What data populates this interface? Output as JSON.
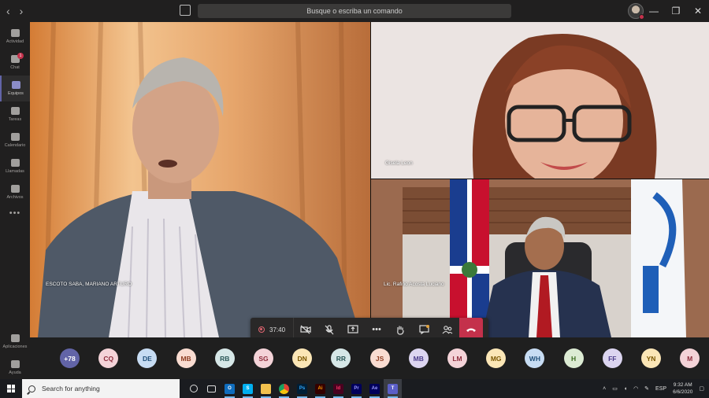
{
  "titlebar": {
    "back": "‹",
    "forward": "›",
    "search_placeholder": "Busque o escriba un comando",
    "minimize": "—",
    "maximize": "❐",
    "close": "✕"
  },
  "rail": {
    "items": [
      {
        "label": "Actividad",
        "icon": "bell-icon"
      },
      {
        "label": "Chat",
        "icon": "chat-icon",
        "badge": "1"
      },
      {
        "label": "Equipos",
        "icon": "teams-icon",
        "active": true
      },
      {
        "label": "Tareas",
        "icon": "tasks-icon"
      },
      {
        "label": "Calendario",
        "icon": "calendar-icon"
      },
      {
        "label": "Llamadas",
        "icon": "phone-icon"
      },
      {
        "label": "Archivos",
        "icon": "files-icon"
      }
    ],
    "more": "•••",
    "bottom": [
      {
        "label": "Aplicaciones",
        "icon": "apps-icon"
      },
      {
        "label": "Ayuda",
        "icon": "help-icon"
      }
    ]
  },
  "tiles": {
    "left_name": "ESCOTO SABA, MARIANO ARTURO",
    "top_right_name": "Gisela Leon",
    "bottom_right_name": "Lic. Rafino Acosta Luciano"
  },
  "controls": {
    "timer": "37:40",
    "icons": [
      "camera-icon",
      "mic-icon",
      "share-icon",
      "more-icon",
      "raise-hand-icon",
      "chat-icon",
      "participants-icon"
    ],
    "hangup_icon": "hangup-icon"
  },
  "participants": [
    {
      "initials": "+78",
      "bg": "#6264a7",
      "fg": "#ffffff"
    },
    {
      "initials": "CQ",
      "bg": "#f4d3d8",
      "fg": "#8e2c3c"
    },
    {
      "initials": "DE",
      "bg": "#c7dcf3",
      "fg": "#1f4e79"
    },
    {
      "initials": "MB",
      "bg": "#f9dcd1",
      "fg": "#8f3e22"
    },
    {
      "initials": "RB",
      "bg": "#d6e7e7",
      "fg": "#2b5757"
    },
    {
      "initials": "SG",
      "bg": "#f4d3d8",
      "fg": "#8e2c3c"
    },
    {
      "initials": "DN",
      "bg": "#fbe6b6",
      "fg": "#7a5600"
    },
    {
      "initials": "RR",
      "bg": "#d6e7e7",
      "fg": "#2b5757"
    },
    {
      "initials": "JS",
      "bg": "#f9dcd1",
      "fg": "#8f3e22"
    },
    {
      "initials": "MB",
      "bg": "#dcd5f0",
      "fg": "#4b3c8a"
    },
    {
      "initials": "LM",
      "bg": "#f4d3d8",
      "fg": "#8e2c3c"
    },
    {
      "initials": "MG",
      "bg": "#fbe6b6",
      "fg": "#7a5600"
    },
    {
      "initials": "WH",
      "bg": "#c7dcf3",
      "fg": "#1f4e79"
    },
    {
      "initials": "H",
      "bg": "#dcebd3",
      "fg": "#3b6b1f"
    },
    {
      "initials": "FF",
      "bg": "#dcd5f0",
      "fg": "#4b3c8a"
    },
    {
      "initials": "YN",
      "bg": "#fbe6b6",
      "fg": "#7a5600"
    },
    {
      "initials": "M",
      "bg": "#f4d3d8",
      "fg": "#8e2c3c"
    }
  ],
  "taskbar": {
    "search_text": "Search for anything",
    "apps": [
      {
        "name": "task-view-icon",
        "label": "",
        "bg": "transparent",
        "fg": "#ddd"
      },
      {
        "name": "taskview-grid-icon",
        "label": "",
        "bg": "transparent",
        "fg": "#ddd"
      },
      {
        "name": "outlook-icon",
        "label": "O",
        "bg": "#0f6cbd",
        "fg": "#fff"
      },
      {
        "name": "skype-icon",
        "label": "S",
        "bg": "#00aff0",
        "fg": "#fff"
      },
      {
        "name": "file-explorer-icon",
        "label": "",
        "bg": "#f2c14e",
        "fg": "#fff"
      },
      {
        "name": "chrome-icon",
        "label": "",
        "bg": "#e34133",
        "fg": "#fff"
      },
      {
        "name": "photoshop-icon",
        "label": "Ps",
        "bg": "#001e36",
        "fg": "#31a8ff"
      },
      {
        "name": "illustrator-icon",
        "label": "Ai",
        "bg": "#330000",
        "fg": "#ff9a00"
      },
      {
        "name": "indesign-icon",
        "label": "Id",
        "bg": "#49021f",
        "fg": "#ff3366"
      },
      {
        "name": "premiere-icon",
        "label": "Pr",
        "bg": "#00005b",
        "fg": "#9999ff"
      },
      {
        "name": "after-effects-icon",
        "label": "Ae",
        "bg": "#00005b",
        "fg": "#9999ff"
      },
      {
        "name": "teams-taskbar-icon",
        "label": "T",
        "bg": "#5b5fc7",
        "fg": "#fff"
      }
    ],
    "language": "ESP",
    "time": "9:32 AM",
    "date": "6/6/2020"
  }
}
